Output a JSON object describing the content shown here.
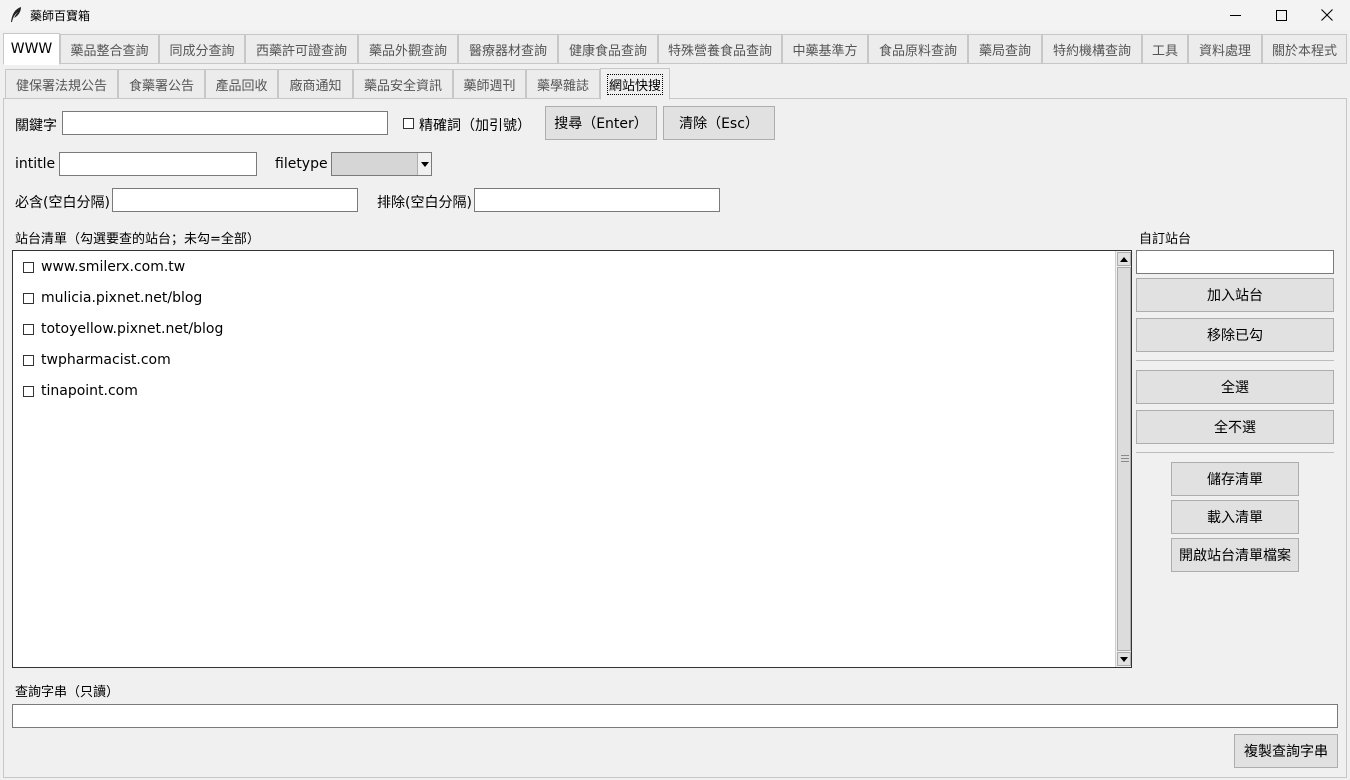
{
  "window": {
    "title": "藥師百寶箱"
  },
  "main_tabs": [
    {
      "label": "WWW"
    },
    {
      "label": "藥品整合查詢"
    },
    {
      "label": "同成分查詢"
    },
    {
      "label": "西藥許可證查詢"
    },
    {
      "label": "藥品外觀查詢"
    },
    {
      "label": "醫療器材查詢"
    },
    {
      "label": "健康食品查詢"
    },
    {
      "label": "特殊營養食品查詢"
    },
    {
      "label": "中藥基準方"
    },
    {
      "label": "食品原料查詢"
    },
    {
      "label": "藥局查詢"
    },
    {
      "label": "特約機構查詢"
    },
    {
      "label": "工具"
    },
    {
      "label": "資料處理"
    },
    {
      "label": "關於本程式"
    }
  ],
  "sub_tabs": [
    {
      "label": "健保署法規公告"
    },
    {
      "label": "食藥署公告"
    },
    {
      "label": "產品回收"
    },
    {
      "label": "廠商通知"
    },
    {
      "label": "藥品安全資訊"
    },
    {
      "label": "藥師週刊"
    },
    {
      "label": "藥學雜誌"
    },
    {
      "label": "網站快搜"
    }
  ],
  "form": {
    "keyword_label": "關鍵字",
    "keyword_value": "",
    "exact_label": "精確詞（加引號）",
    "search_button": "搜尋（Enter）",
    "clear_button": "清除（Esc）",
    "intitle_label": "intitle",
    "intitle_value": "",
    "filetype_label": "filetype",
    "filetype_value": "",
    "must_label": "必含(空白分隔)",
    "must_value": "",
    "exclude_label": "排除(空白分隔)",
    "exclude_value": ""
  },
  "site_list": {
    "label": "站台清單（勾選要查的站台；未勾=全部）",
    "items": [
      {
        "label": "www.smilerx.com.tw",
        "checked": false
      },
      {
        "label": "mulicia.pixnet.net/blog",
        "checked": false
      },
      {
        "label": "totoyellow.pixnet.net/blog",
        "checked": false
      },
      {
        "label": "twpharmacist.com",
        "checked": false
      },
      {
        "label": "tinapoint.com",
        "checked": false
      }
    ]
  },
  "custom_site": {
    "label": "自訂站台",
    "value": "",
    "add_button": "加入站台",
    "remove_button": "移除已勾",
    "select_all_button": "全選",
    "select_none_button": "全不選",
    "save_button": "儲存清單",
    "load_button": "載入清單",
    "open_file_button": "開啟站台清單檔案"
  },
  "query": {
    "label": "查詢字串（只讀）",
    "value": "",
    "copy_button": "複製查詢字串"
  },
  "icons": {
    "app": "feather-icon",
    "minimize": "minimize-icon",
    "maximize": "maximize-icon",
    "close": "close-icon",
    "dropdown": "chevron-down-icon",
    "scroll_up": "arrow-up-icon",
    "scroll_down": "arrow-down-icon"
  }
}
